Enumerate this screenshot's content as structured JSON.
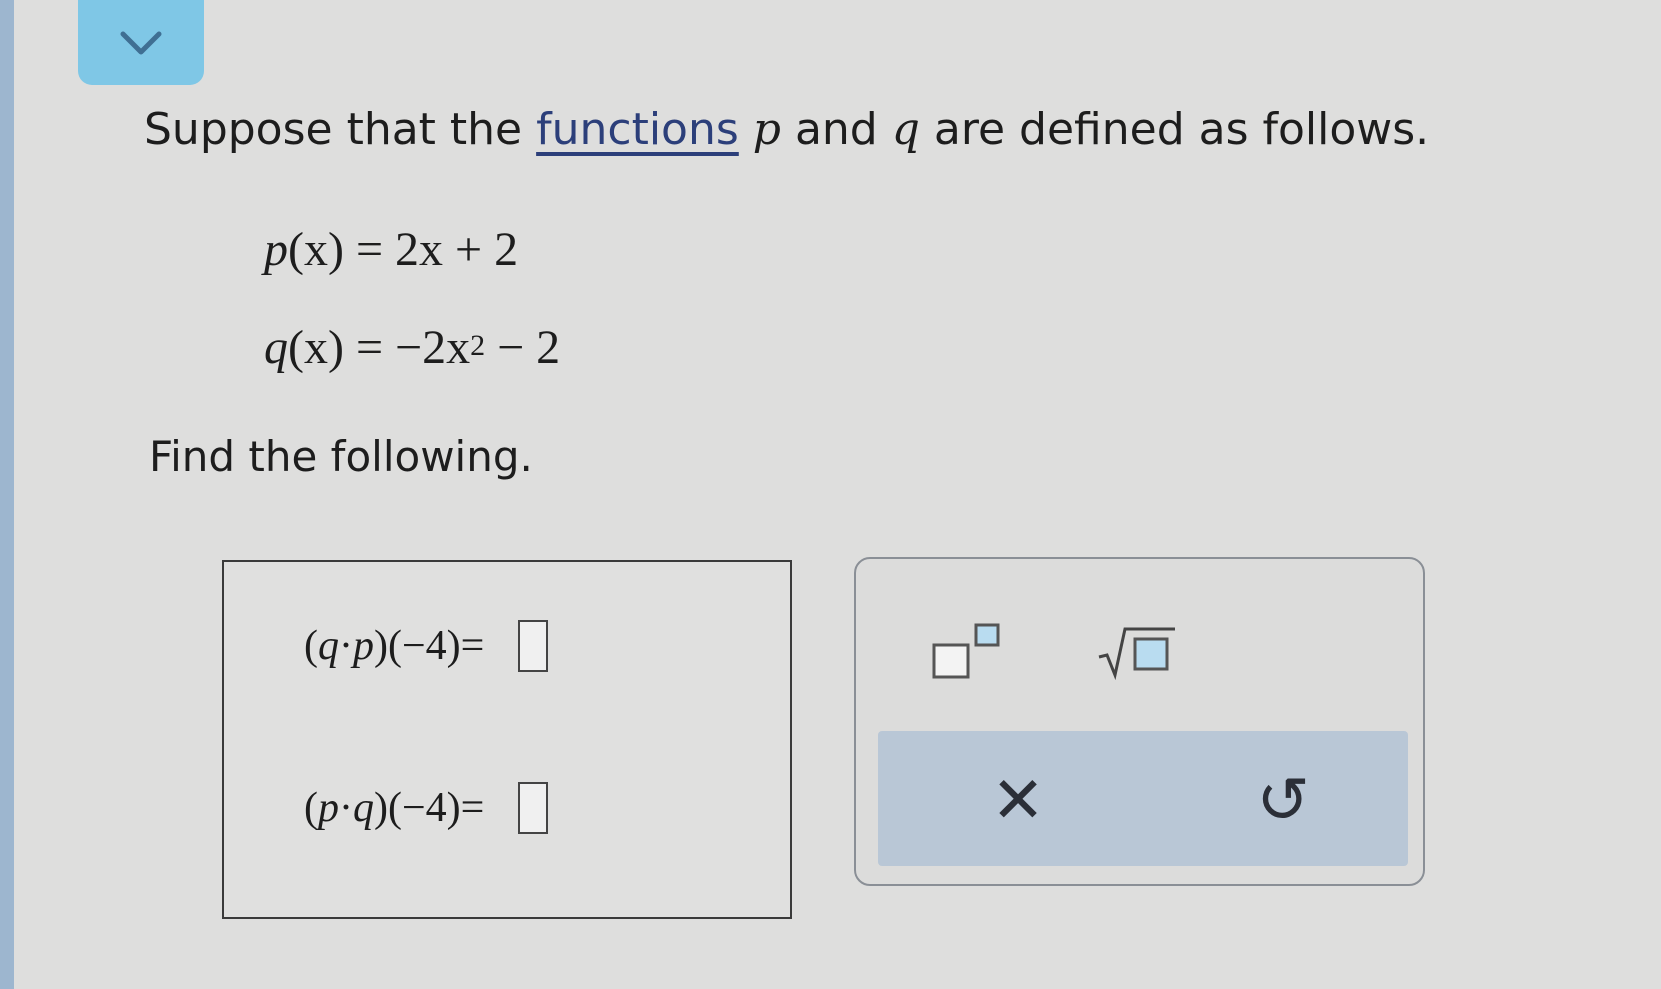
{
  "intro": {
    "before_link": "Suppose that the ",
    "link_text": "functions",
    "var_p": "p",
    "word_and": " and ",
    "var_q": "q",
    "after": " are defined as follows."
  },
  "equations": {
    "p_name": "p",
    "p_rhs": "(x) = 2x + 2",
    "q_name": "q",
    "q_rhs_a": "(x) = −2x",
    "q_exp": "2",
    "q_rhs_b": " − 2"
  },
  "find_text": "Find the following.",
  "answers": [
    {
      "lhs_open": "(",
      "f1": "q",
      "dot": " · ",
      "f2": "p",
      "lhs_close": ")(−4)",
      "eq": " =",
      "value": ""
    },
    {
      "lhs_open": "(",
      "f1": "p",
      "dot": " · ",
      "f2": "q",
      "lhs_close": ")(−4)",
      "eq": " =",
      "value": ""
    }
  ],
  "toolbar": {
    "clear_glyph": "✕",
    "undo_glyph": "↺"
  },
  "icons": [
    "chevron-down-icon",
    "superscript-icon",
    "square-root-icon",
    "clear-icon",
    "undo-icon"
  ],
  "colors": {
    "accent": "#7fc7e6",
    "link": "#2c3f7a",
    "action_bar": "#b9c7d6"
  }
}
